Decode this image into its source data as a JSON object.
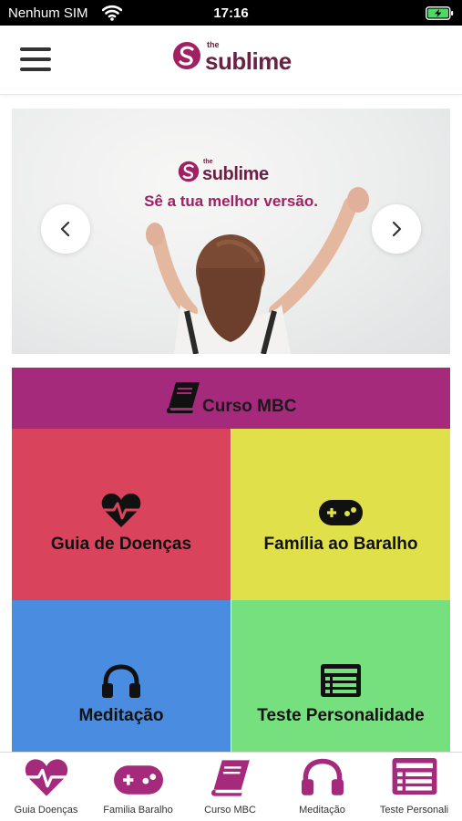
{
  "status_bar": {
    "carrier": "Nenhum SIM",
    "time": "17:16",
    "wifi_icon": "wifi-icon",
    "battery_icon": "battery-charging-icon"
  },
  "header": {
    "menu_icon": "hamburger-menu-icon",
    "logo": {
      "small": "the",
      "word": "sublime"
    }
  },
  "carousel": {
    "logo": {
      "small": "the",
      "word": "sublime"
    },
    "tagline": "Sê a tua melhor versão.",
    "prev_icon": "chevron-left-icon",
    "next_icon": "chevron-right-icon"
  },
  "tiles": {
    "course": {
      "label": "Curso MBC",
      "icon": "book-icon",
      "color": "#a52a7c"
    },
    "guide": {
      "label": "Guia de Doenças",
      "icon": "heartbeat-icon",
      "color": "#d9435c"
    },
    "family": {
      "label": "Família ao Baralho",
      "icon": "gamepad-icon",
      "color": "#dfe04a"
    },
    "meditation": {
      "label": "Meditação",
      "icon": "headphones-icon",
      "color": "#4a8de0"
    },
    "test": {
      "label": "Teste Personalidade",
      "icon": "list-icon",
      "color": "#77e07e"
    }
  },
  "bottom_nav": {
    "accent": "#a52a7c",
    "items": [
      {
        "label": "Guia Doenças",
        "icon": "heartbeat-icon"
      },
      {
        "label": "Familia Baralho",
        "icon": "gamepad-icon"
      },
      {
        "label": "Curso MBC",
        "icon": "book-icon"
      },
      {
        "label": "Meditação",
        "icon": "headphones-icon"
      },
      {
        "label": "Teste Personali",
        "icon": "list-icon"
      }
    ]
  }
}
